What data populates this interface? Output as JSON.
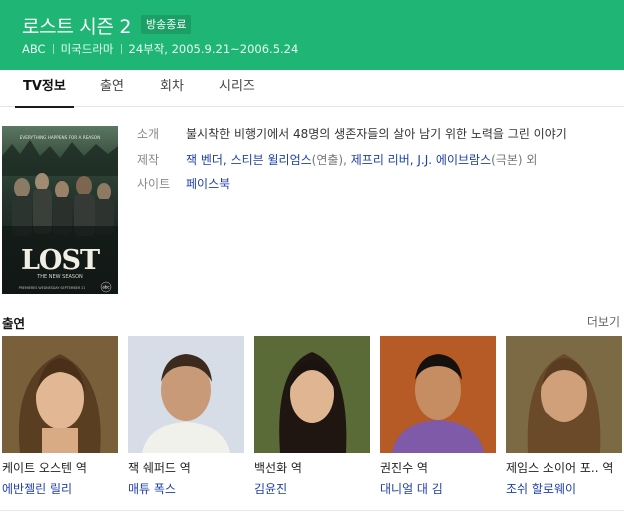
{
  "header": {
    "title": "로스트 시즌 2",
    "badge": "방송종료",
    "meta": [
      "ABC",
      "미국드라마",
      "24부작, 2005.9.21~2006.5.24"
    ],
    "bg_color": "#1fb575"
  },
  "tabs": [
    {
      "label": "TV정보",
      "active": true
    },
    {
      "label": "출연",
      "active": false
    },
    {
      "label": "회차",
      "active": false
    },
    {
      "label": "시리즈",
      "active": false
    }
  ],
  "poster": {
    "tagline": "EVERYTHING HAPPENS FOR A REASON",
    "logo": "LOST",
    "subtitle": "THE NEW SEASON",
    "premiere": "PREMIERES WEDNESDAY SEPTEMBER 21",
    "network": "abc"
  },
  "info": {
    "intro": {
      "label": "소개",
      "value": "불시착한 비행기에서 48명의 생존자들의 살아 남기 위한 노력을 그린 이야기"
    },
    "production": {
      "label": "제작",
      "parts": [
        {
          "text": "잭 벤더, 스티븐 윌리엄스",
          "link": true
        },
        {
          "text": "(연출), ",
          "link": false
        },
        {
          "text": "제프리 리버, J.J. 에이브람스",
          "link": true
        },
        {
          "text": "(극본) 외",
          "link": false
        }
      ]
    },
    "site": {
      "label": "사이트",
      "value": "페이스북"
    }
  },
  "cast": {
    "title": "출연",
    "more_label": "더보기",
    "items": [
      {
        "role": "케이트 오스텐 역",
        "name": "에반젤린 릴리"
      },
      {
        "role": "잭 쉐퍼드 역",
        "name": "매튜 폭스"
      },
      {
        "role": "백선화 역",
        "name": "김윤진"
      },
      {
        "role": "권진수 역",
        "name": "대니얼 대 김"
      },
      {
        "role": "제임스 소이어 포.. 역",
        "name": "조쉬 할로웨이"
      }
    ]
  }
}
